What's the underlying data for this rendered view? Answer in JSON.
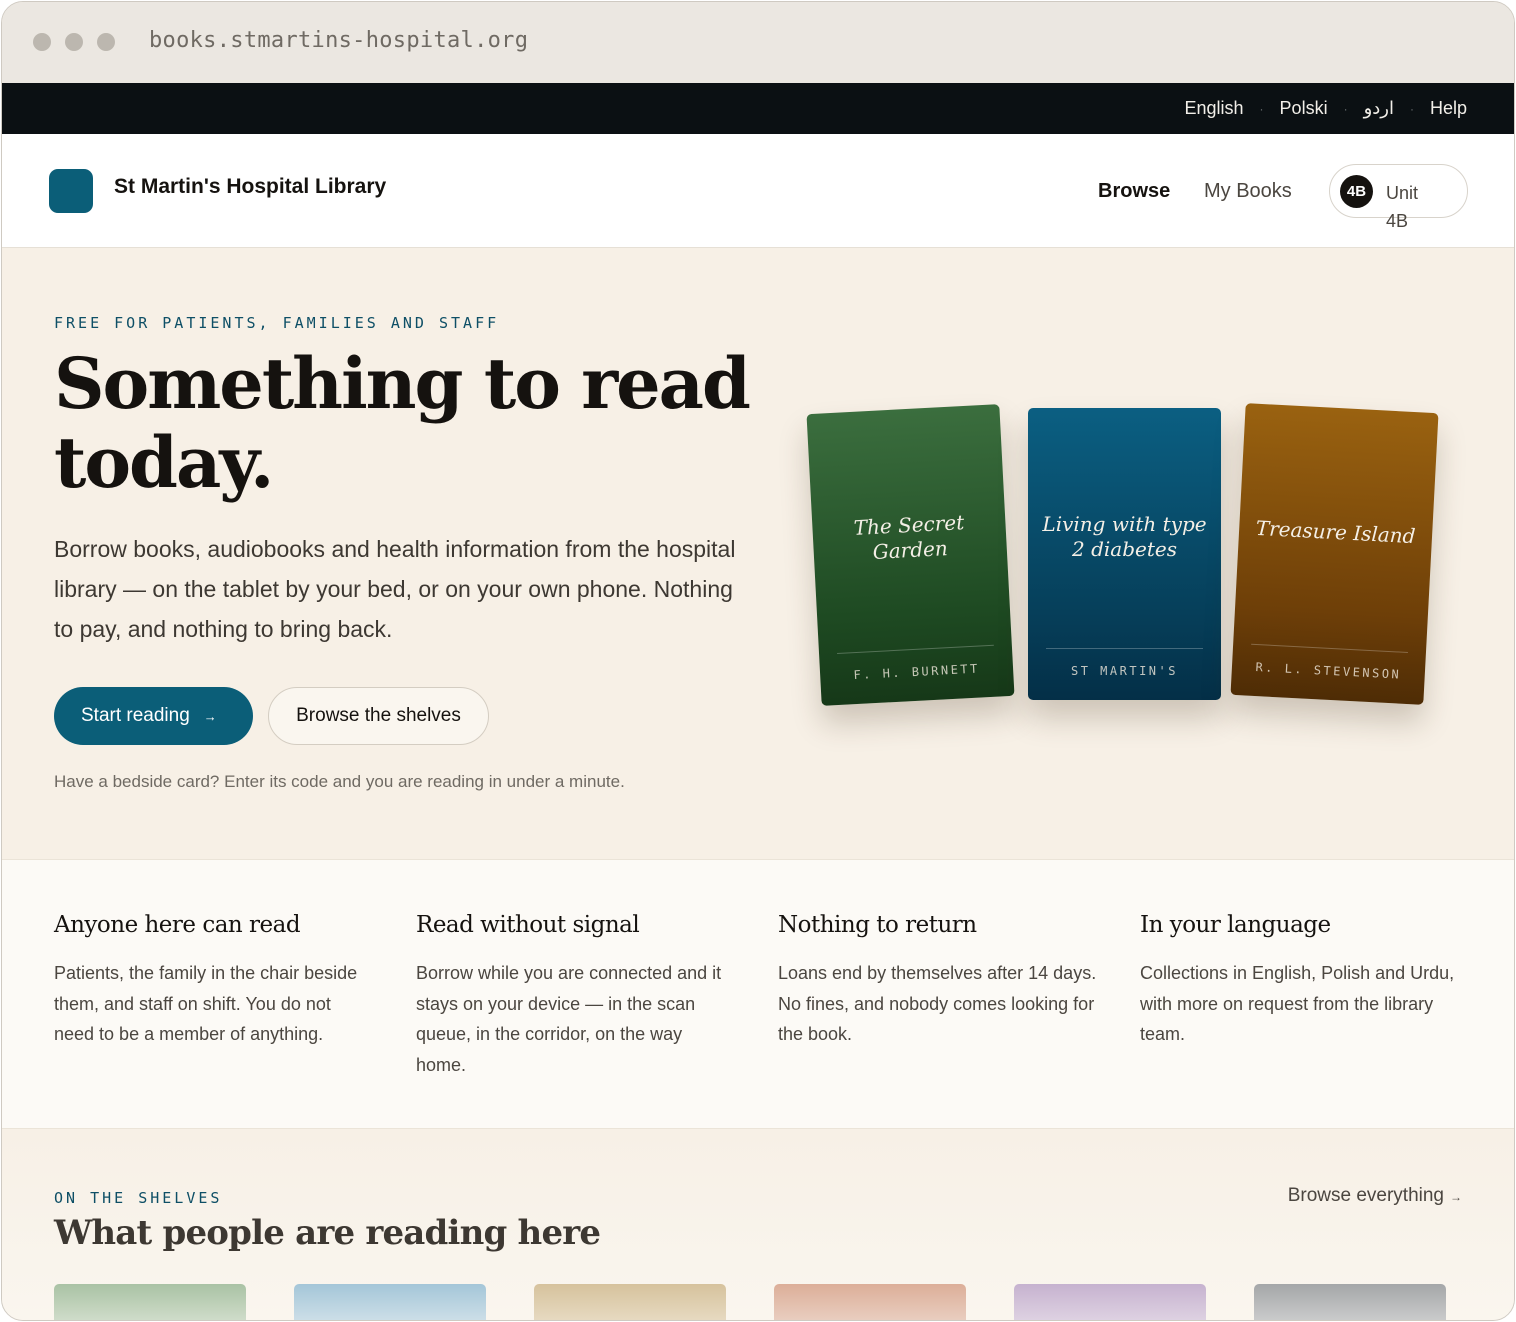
{
  "browser": {
    "url": "books.stmartins-hospital.org"
  },
  "language_bar": {
    "items": [
      "English",
      "Polski",
      "اردو",
      "Help"
    ]
  },
  "header": {
    "brand": "St Martin's Hospital Library",
    "nav": {
      "browse": "Browse",
      "my_books": "My Books"
    },
    "unit": {
      "badge": "4B",
      "label": "Unit 4B"
    }
  },
  "hero": {
    "eyebrow": "FREE FOR PATIENTS, FAMILIES AND STAFF",
    "title": "Something to read today.",
    "text": "Borrow books, audiobooks and health information from the hospital library — on the tablet by your bed, or on your own phone. Nothing to pay, and nothing to bring back.",
    "primary_button": "Start reading",
    "primary_arrow": "→",
    "secondary_button": "Browse the shelves",
    "note": "Have a bedside card? Enter its code and you are reading in under a minute.",
    "books": [
      {
        "title": "The Secret Garden",
        "author": "F. H. BURNETT",
        "color": "#2a5a2d"
      },
      {
        "title": "Living with type 2 diabetes",
        "author": "ST MARTIN'S",
        "color": "#064e6e"
      },
      {
        "title": "Treasure Island",
        "author": "R. L. STEVENSON",
        "color": "#7a470a"
      }
    ]
  },
  "features": [
    {
      "title": "Anyone here can read",
      "text": "Patients, the family in the chair beside them, and staff on shift. You do not need to be a member of anything."
    },
    {
      "title": "Read without signal",
      "text": "Borrow while you are connected and it stays on your device — in the scan queue, in the corridor, on the way home."
    },
    {
      "title": "Nothing to return",
      "text": "Loans end by themselves after 14 days. No fines, and nobody comes looking for the book."
    },
    {
      "title": "In your language",
      "text": "Collections in English, Polish and Urdu, with more on request from the library team."
    }
  ],
  "shelves": {
    "eyebrow": "ON THE SHELVES",
    "title": "What people are reading here",
    "browse_all": "Browse everything",
    "arrow": "→"
  },
  "colors": {
    "accent": "#0b5e78",
    "hero_bg": "#f7f0e6",
    "topbar_bg": "#0b1013"
  }
}
